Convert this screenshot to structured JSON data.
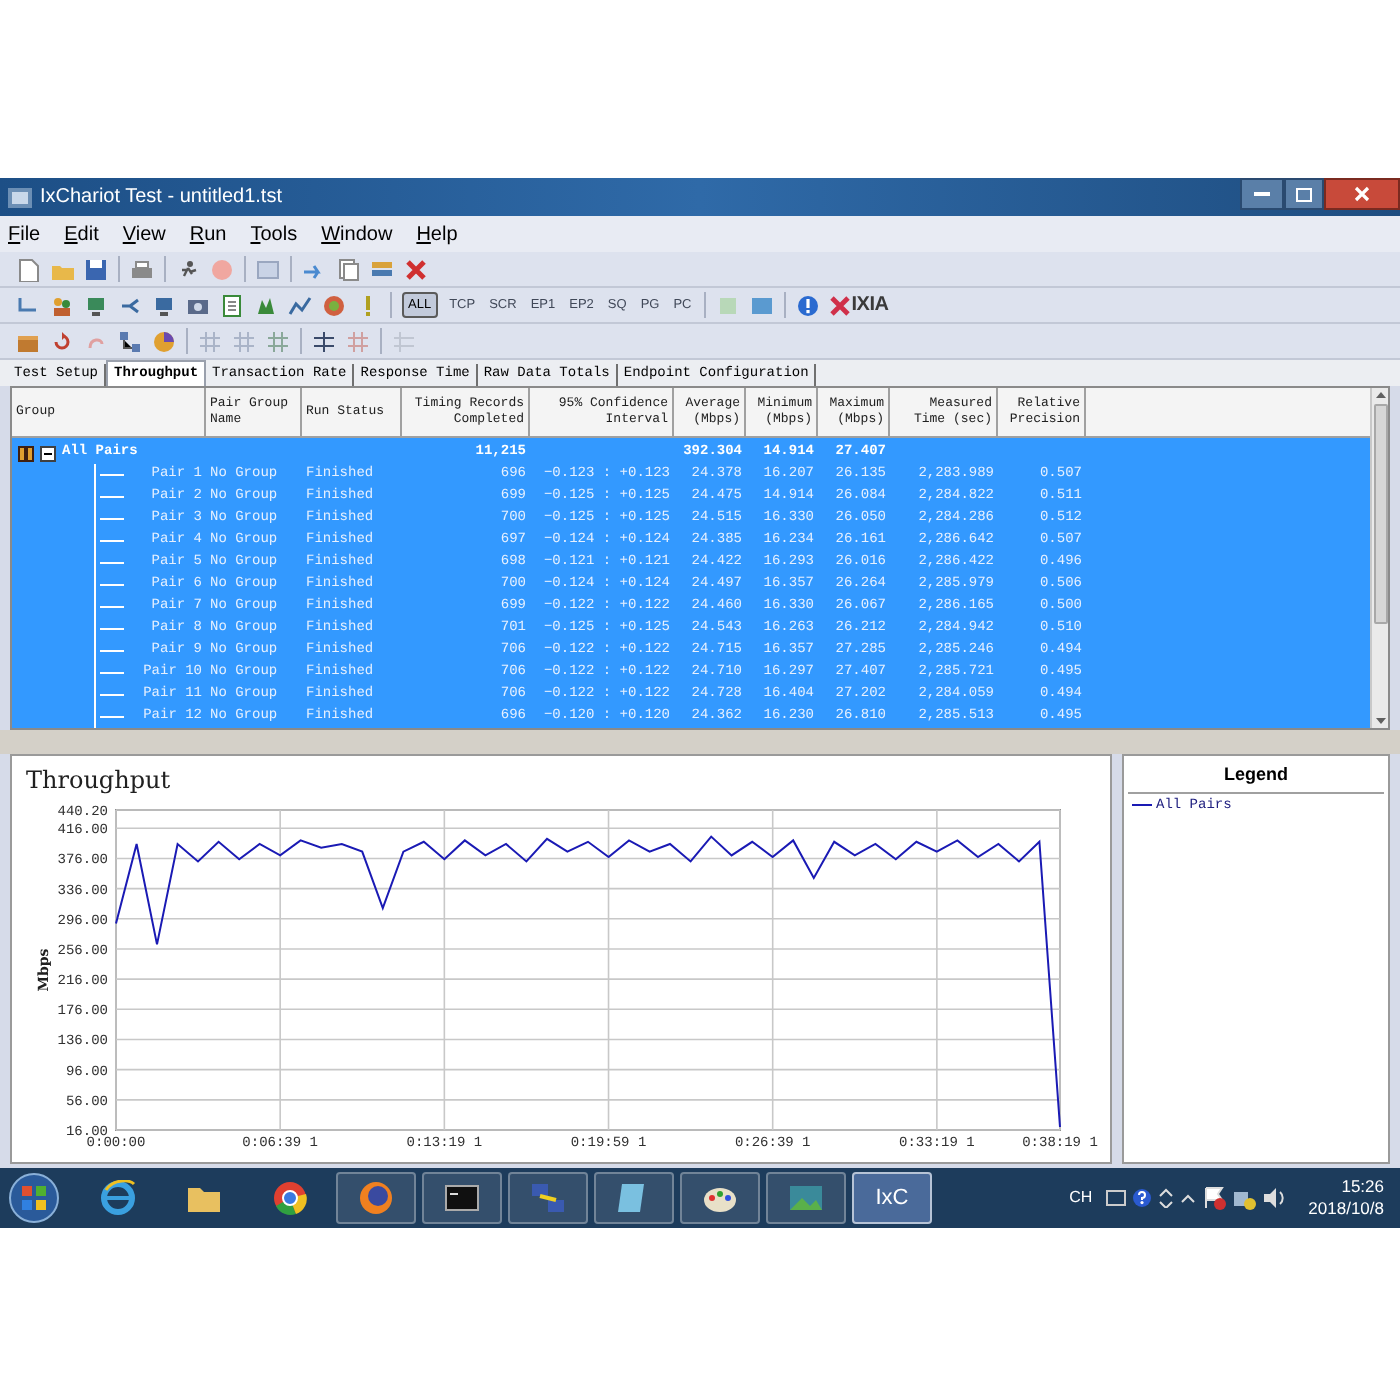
{
  "window": {
    "title": "IxChariot Test - untitled1.tst"
  },
  "menu": [
    "File",
    "Edit",
    "View",
    "Run",
    "Tools",
    "Window",
    "Help"
  ],
  "filter_buttons": [
    {
      "label": "ALL",
      "selected": true
    },
    {
      "label": "TCP",
      "selected": false
    },
    {
      "label": "SCR",
      "selected": false
    },
    {
      "label": "EP1",
      "selected": false
    },
    {
      "label": "EP2",
      "selected": false
    },
    {
      "label": "SQ",
      "selected": false
    },
    {
      "label": "PG",
      "selected": false
    },
    {
      "label": "PC",
      "selected": false
    }
  ],
  "logo": "IXIA",
  "tabs": [
    {
      "label": "Test Setup",
      "selected": false
    },
    {
      "label": "Throughput",
      "selected": true
    },
    {
      "label": "Transaction Rate",
      "selected": false
    },
    {
      "label": "Response Time",
      "selected": false
    },
    {
      "label": "Raw Data Totals",
      "selected": false
    },
    {
      "label": "Endpoint Configuration",
      "selected": false
    }
  ],
  "table": {
    "columns": [
      "Group",
      "Pair Group Name",
      "Run Status",
      "Timing Records Completed",
      "95% Confidence Interval",
      "Average (Mbps)",
      "Minimum (Mbps)",
      "Maximum (Mbps)",
      "Measured Time (sec)",
      "Relative Precision"
    ],
    "summary": {
      "group": "All Pairs",
      "expanded": true,
      "selected": true,
      "records": "11,215",
      "average": "392.304",
      "minimum": "14.914",
      "maximum": "27.407"
    },
    "rows": [
      {
        "pair": "Pair 1",
        "group_name": "No Group",
        "status": "Finished",
        "records": "696",
        "interval": "−0.123 : +0.123",
        "average": "24.378",
        "minimum": "16.207",
        "maximum": "26.135",
        "time": "2,283.989",
        "precision": "0.507",
        "selected": true
      },
      {
        "pair": "Pair 2",
        "group_name": "No Group",
        "status": "Finished",
        "records": "699",
        "interval": "−0.125 : +0.125",
        "average": "24.475",
        "minimum": "14.914",
        "maximum": "26.084",
        "time": "2,284.822",
        "precision": "0.511",
        "selected": true
      },
      {
        "pair": "Pair 3",
        "group_name": "No Group",
        "status": "Finished",
        "records": "700",
        "interval": "−0.125 : +0.125",
        "average": "24.515",
        "minimum": "16.330",
        "maximum": "26.050",
        "time": "2,284.286",
        "precision": "0.512",
        "selected": true
      },
      {
        "pair": "Pair 4",
        "group_name": "No Group",
        "status": "Finished",
        "records": "697",
        "interval": "−0.124 : +0.124",
        "average": "24.385",
        "minimum": "16.234",
        "maximum": "26.161",
        "time": "2,286.642",
        "precision": "0.507",
        "selected": true
      },
      {
        "pair": "Pair 5",
        "group_name": "No Group",
        "status": "Finished",
        "records": "698",
        "interval": "−0.121 : +0.121",
        "average": "24.422",
        "minimum": "16.293",
        "maximum": "26.016",
        "time": "2,286.422",
        "precision": "0.496",
        "selected": true
      },
      {
        "pair": "Pair 6",
        "group_name": "No Group",
        "status": "Finished",
        "records": "700",
        "interval": "−0.124 : +0.124",
        "average": "24.497",
        "minimum": "16.357",
        "maximum": "26.264",
        "time": "2,285.979",
        "precision": "0.506",
        "selected": true
      },
      {
        "pair": "Pair 7",
        "group_name": "No Group",
        "status": "Finished",
        "records": "699",
        "interval": "−0.122 : +0.122",
        "average": "24.460",
        "minimum": "16.330",
        "maximum": "26.067",
        "time": "2,286.165",
        "precision": "0.500",
        "selected": true
      },
      {
        "pair": "Pair 8",
        "group_name": "No Group",
        "status": "Finished",
        "records": "701",
        "interval": "−0.125 : +0.125",
        "average": "24.543",
        "minimum": "16.263",
        "maximum": "26.212",
        "time": "2,284.942",
        "precision": "0.510",
        "selected": true
      },
      {
        "pair": "Pair 9",
        "group_name": "No Group",
        "status": "Finished",
        "records": "706",
        "interval": "−0.122 : +0.122",
        "average": "24.715",
        "minimum": "16.357",
        "maximum": "27.285",
        "time": "2,285.246",
        "precision": "0.494",
        "selected": true
      },
      {
        "pair": "Pair 10",
        "group_name": "No Group",
        "status": "Finished",
        "records": "706",
        "interval": "−0.122 : +0.122",
        "average": "24.710",
        "minimum": "16.297",
        "maximum": "27.407",
        "time": "2,285.721",
        "precision": "0.495",
        "selected": true
      },
      {
        "pair": "Pair 11",
        "group_name": "No Group",
        "status": "Finished",
        "records": "706",
        "interval": "−0.122 : +0.122",
        "average": "24.728",
        "minimum": "16.404",
        "maximum": "27.202",
        "time": "2,284.059",
        "precision": "0.494",
        "selected": true
      },
      {
        "pair": "Pair 12",
        "group_name": "No Group",
        "status": "Finished",
        "records": "696",
        "interval": "−0.120 : +0.120",
        "average": "24.362",
        "minimum": "16.230",
        "maximum": "26.810",
        "time": "2,285.513",
        "precision": "0.495",
        "selected": true
      }
    ]
  },
  "chart": {
    "chart_data": {
      "type": "line",
      "title": "Throughput",
      "ylabel": "Mbps",
      "categories": [
        "0:00:00",
        null,
        null,
        null,
        null,
        null,
        null,
        null,
        "0:06:39 1",
        null,
        null,
        null,
        null,
        null,
        null,
        null,
        "0:13:19 1",
        null,
        null,
        null,
        null,
        null,
        null,
        null,
        "0:19:59 1",
        null,
        null,
        null,
        null,
        null,
        null,
        null,
        "0:26:39 1",
        null,
        null,
        null,
        null,
        null,
        null,
        null,
        "0:33:19 1",
        null,
        null,
        null,
        null,
        null,
        "0:38:19 1"
      ],
      "series": [
        {
          "name": "All Pairs",
          "color": "#1a1ab4",
          "values": [
            290,
            395,
            262,
            395,
            372,
            398,
            375,
            395,
            380,
            400,
            390,
            395,
            385,
            310,
            385,
            398,
            375,
            400,
            380,
            395,
            372,
            402,
            385,
            398,
            378,
            400,
            385,
            395,
            372,
            405,
            380,
            398,
            378,
            400,
            350,
            398,
            380,
            395,
            375,
            398,
            385,
            400,
            378,
            395,
            372,
            398,
            20
          ]
        }
      ],
      "ylim": [
        16,
        440.2
      ],
      "grid": true,
      "yticks": [
        {
          "value": 16,
          "label": "16.00"
        },
        {
          "value": 56,
          "label": "56.00"
        },
        {
          "value": 96,
          "label": "96.00"
        },
        {
          "value": 136,
          "label": "136.00"
        },
        {
          "value": 176,
          "label": "176.00"
        },
        {
          "value": 216,
          "label": "216.00"
        },
        {
          "value": 256,
          "label": "256.00"
        },
        {
          "value": 296,
          "label": "296.00"
        },
        {
          "value": 336,
          "label": "336.00"
        },
        {
          "value": 376,
          "label": "376.00"
        },
        {
          "value": 416,
          "label": "416.00"
        },
        {
          "value": 440.2,
          "label": "440.20"
        }
      ]
    }
  },
  "legend": {
    "title": "Legend"
  },
  "taskbar": {
    "app_label": "IxC",
    "language": "CH",
    "time": "15:26",
    "date": "2018/10/8"
  }
}
